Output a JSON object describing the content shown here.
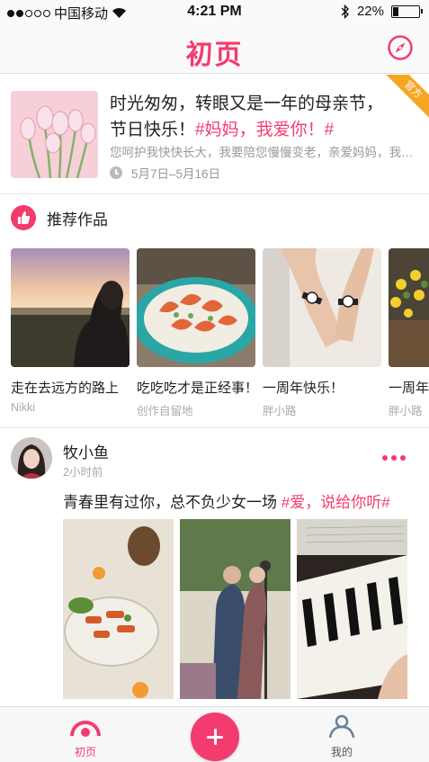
{
  "status_bar": {
    "carrier": "中国移动",
    "time": "4:21 PM",
    "battery": "22%",
    "battery_level": 0.22
  },
  "nav": {
    "title": "初页",
    "compass_icon": "compass-icon"
  },
  "featured": {
    "badge": "官方",
    "title_line1": "时光匆匆，转眼又是一年的母亲节，",
    "title_line2_plain": "节日快乐！",
    "title_line2_tag": "#妈妈，我爱你！#",
    "description": "您呵护我快快长大，我要陪您慢慢变老，亲爱妈妈，我…",
    "date_range": "5月7日–5月16日",
    "thumb_icon": "tulip-image"
  },
  "recommended": {
    "title": "推荐作品",
    "icon": "thumbs-up-icon",
    "items": [
      {
        "caption": "走在去远方的路上",
        "author": "Nikki"
      },
      {
        "caption": "吃吃吃才是正经事！",
        "author": "创作自留地"
      },
      {
        "caption": "一周年快乐！",
        "author": "胖小路"
      },
      {
        "caption": "一周年",
        "author": "胖小路"
      }
    ]
  },
  "post": {
    "username": "牧小鱼",
    "time": "2小时前",
    "text_plain": "青春里有过你，总不负少女一场 ",
    "text_tag": "#爱，说给你听#"
  },
  "tabbar": {
    "home_label": "初页",
    "me_label": "我的"
  },
  "colors": {
    "accent": "#f23c6e",
    "badge": "#f6a623"
  }
}
